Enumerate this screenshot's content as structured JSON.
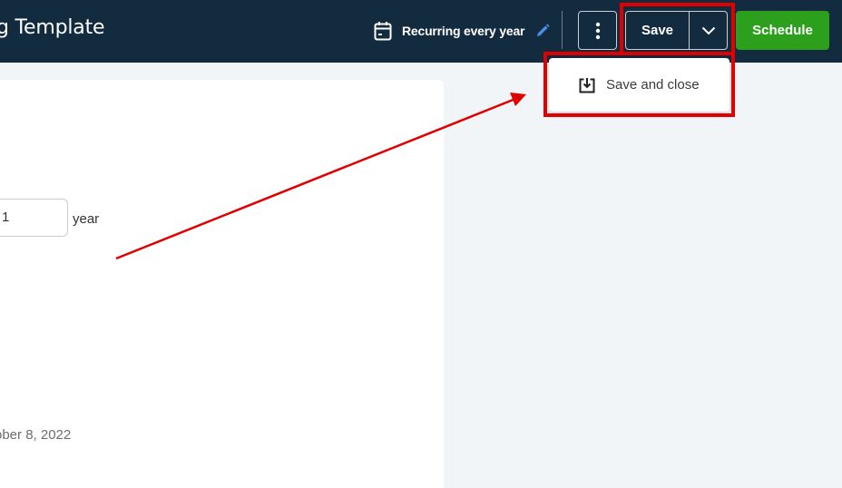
{
  "header": {
    "title": "g Template",
    "recurring_text": "Recurring every year",
    "save_label": "Save",
    "schedule_label": "Schedule"
  },
  "dropdown": {
    "items": [
      {
        "label": "Save and close",
        "icon": "save-and-close-icon"
      }
    ]
  },
  "form": {
    "interval_value": "1",
    "interval_unit": "year",
    "date_text": "ober 8, 2022"
  },
  "colors": {
    "header_bg": "#132b3e",
    "schedule_green": "#2ca01c",
    "annotation_red": "#e00000",
    "page_bg": "#f1f5f8"
  },
  "icons": [
    "calendar-icon",
    "pencil-icon",
    "more-vertical-icon",
    "chevron-down-icon",
    "save-and-close-icon"
  ]
}
